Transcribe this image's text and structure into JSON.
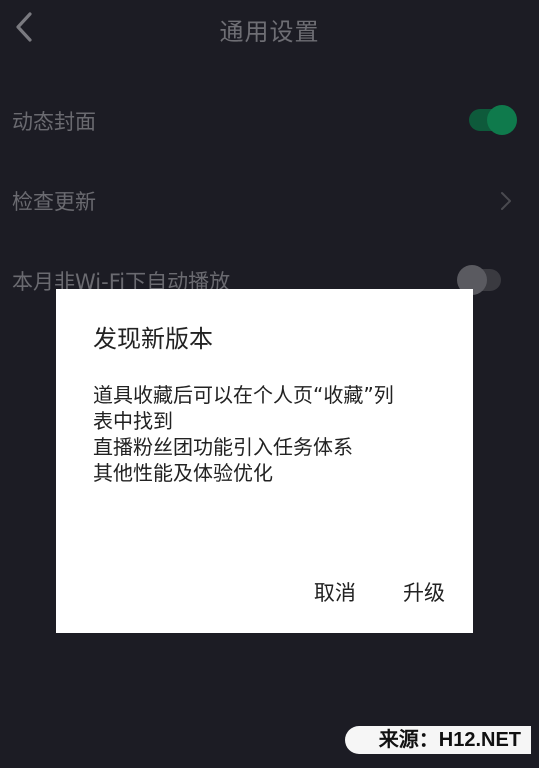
{
  "header": {
    "title": "通用设置",
    "back_icon": "back-arrow-icon"
  },
  "settings": {
    "items": [
      {
        "label": "动态封面",
        "control": "toggle",
        "state": "on"
      },
      {
        "label": "检查更新",
        "control": "chevron",
        "icon": "chevron-right-icon"
      },
      {
        "label": "本月非Wi-Fi下自动播放",
        "control": "toggle",
        "state": "off"
      }
    ]
  },
  "dialog": {
    "title": "发现新版本",
    "body_lines": [
      "道具收藏后可以在个人页“收藏”列",
      "表中找到",
      "直播粉丝团功能引入任务体系",
      "其他性能及体验优化"
    ],
    "cancel_label": "取消",
    "upgrade_label": "升级"
  },
  "watermark": {
    "text": "来源：H12.NET"
  },
  "colors": {
    "background": "#1c1c24",
    "toggle_on": "#0f7a4c",
    "dialog_bg": "#ffffff"
  }
}
